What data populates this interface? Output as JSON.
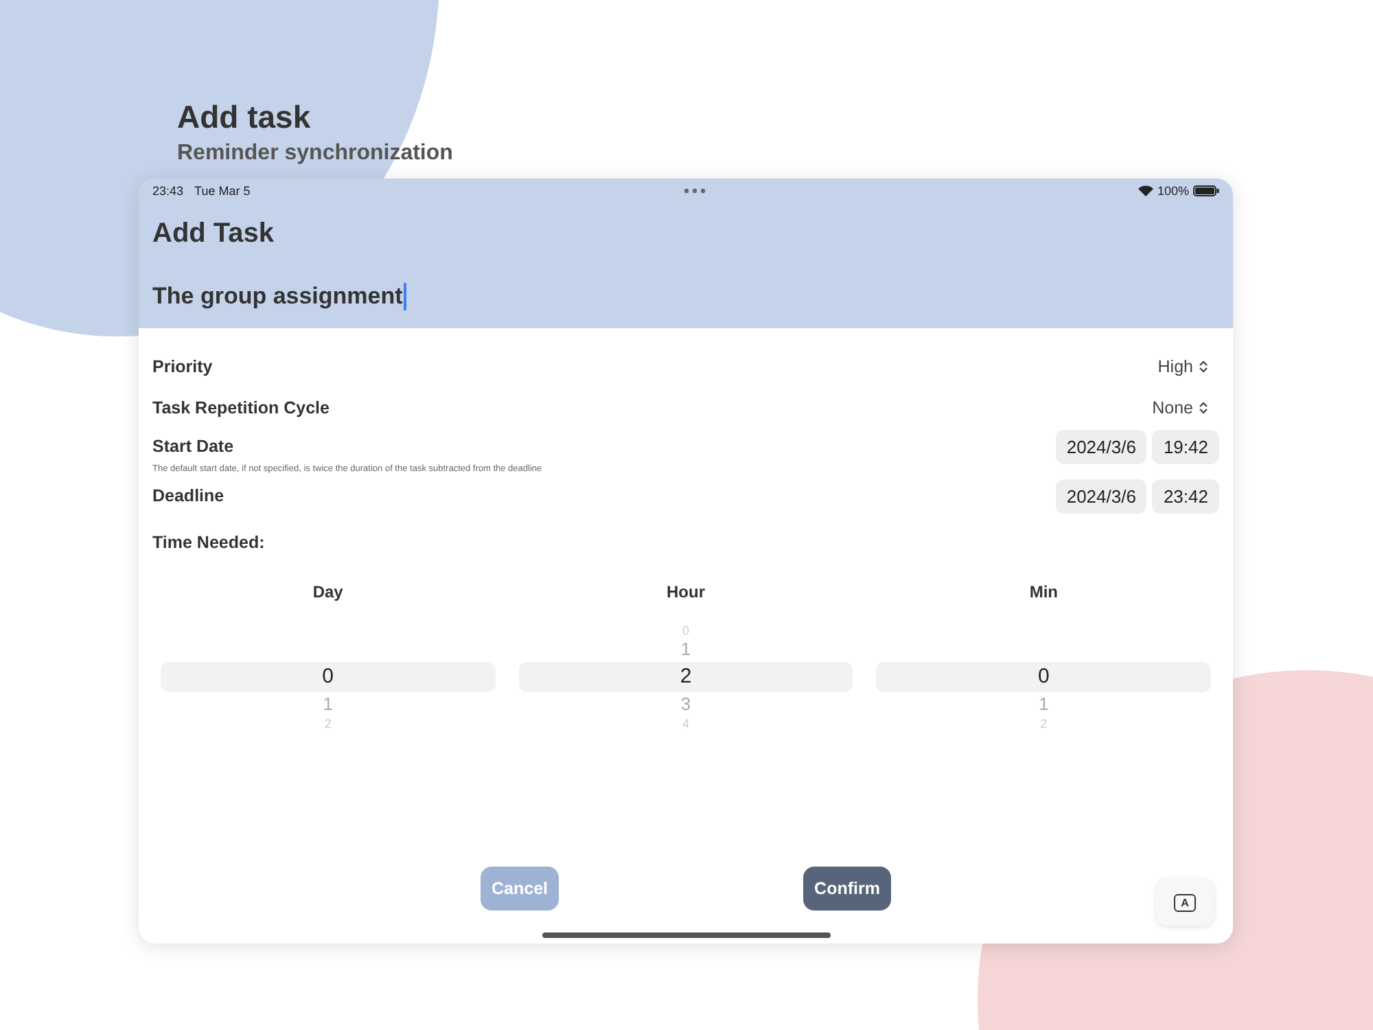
{
  "page": {
    "title": "Add task",
    "subtitle": "Reminder synchronization"
  },
  "status_bar": {
    "time": "23:43",
    "date": "Tue Mar 5",
    "battery": "100%"
  },
  "screen": {
    "title": "Add Task",
    "task_name": {
      "value": "The group assignment",
      "focused": true
    }
  },
  "rows": [
    {
      "kind": "menu",
      "label": "Priority",
      "value": "High"
    },
    {
      "kind": "menu",
      "label": "Task Repetition Cycle",
      "value": "None"
    },
    {
      "kind": "datetime",
      "label": "Start Date",
      "date": "2024/3/6",
      "time": "19:42",
      "note": "The default start date, if not specified, is twice the duration of the task subtracted from the deadline"
    },
    {
      "kind": "datetime",
      "label": "Deadline",
      "date": "2024/3/6",
      "time": "23:42"
    }
  ],
  "time_needed": {
    "label": "Time Needed:",
    "columns": [
      {
        "heading": "Day",
        "value": "0",
        "below": [
          "1",
          "2"
        ]
      },
      {
        "heading": "Hour",
        "above": [
          "0",
          "1"
        ],
        "value": "2",
        "below": [
          "3",
          "4"
        ]
      },
      {
        "heading": "Min",
        "value": "0",
        "below": [
          "1",
          "2"
        ]
      }
    ]
  },
  "buttons": [
    {
      "label": "Cancel",
      "disabled": true
    },
    {
      "label": "Confirm",
      "disabled": false
    }
  ],
  "keyboard_key": "A"
}
